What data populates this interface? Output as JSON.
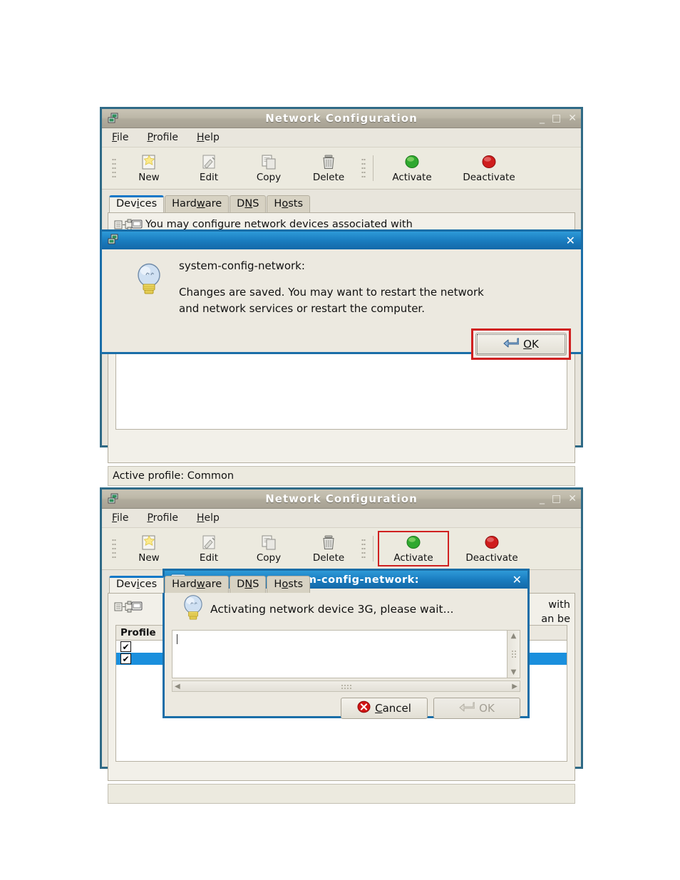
{
  "window1": {
    "title": "Network Configuration",
    "app_icon": "network-devices-icon",
    "controls": {
      "minimize": "_",
      "maximize": "□",
      "close": "✕"
    },
    "menubar": [
      {
        "label": "File",
        "mnemonic": "F"
      },
      {
        "label": "Profile",
        "mnemonic": "P"
      },
      {
        "label": "Help",
        "mnemonic": "H"
      }
    ],
    "toolbar": [
      {
        "label": "New",
        "icon": "new-document-icon",
        "highlighted": false
      },
      {
        "label": "Edit",
        "icon": "edit-pencil-icon",
        "highlighted": false
      },
      {
        "label": "Copy",
        "icon": "copy-pages-icon",
        "highlighted": false
      },
      {
        "label": "Delete",
        "icon": "trash-can-icon",
        "highlighted": false
      },
      {
        "label": "Activate",
        "icon": "green-light-icon",
        "highlighted": false
      },
      {
        "label": "Deactivate",
        "icon": "red-light-icon",
        "highlighted": false
      }
    ],
    "tabs": [
      {
        "label": "Devices",
        "mnemonic": "i",
        "active": true
      },
      {
        "label": "Hardware",
        "mnemonic": "w",
        "active": false
      },
      {
        "label": "DNS",
        "mnemonic": "N",
        "active": false
      },
      {
        "label": "Hosts",
        "mnemonic": "o",
        "active": false
      }
    ],
    "description_line1": "You may configure network devices associated with",
    "statusbar": "Active profile: Common"
  },
  "dialog1": {
    "title": "",
    "app_icon": "network-devices-icon",
    "close": "✕",
    "bulb_icon": "light-bulb-icon",
    "heading": "system-config-network:",
    "message_line1": "Changes are saved. You may want to restart the network",
    "message_line2": "and network services or restart the computer.",
    "ok_button": {
      "label": "OK",
      "mnemonic": "O",
      "icon": "enter-arrow-icon",
      "highlighted": true
    }
  },
  "window2": {
    "title": "Network Configuration",
    "app_icon": "network-devices-icon",
    "controls": {
      "minimize": "_",
      "maximize": "□",
      "close": "✕"
    },
    "menubar": [
      {
        "label": "File",
        "mnemonic": "F"
      },
      {
        "label": "Profile",
        "mnemonic": "P"
      },
      {
        "label": "Help",
        "mnemonic": "H"
      }
    ],
    "toolbar": [
      {
        "label": "New",
        "icon": "new-document-icon",
        "highlighted": false
      },
      {
        "label": "Edit",
        "icon": "edit-pencil-icon",
        "highlighted": false
      },
      {
        "label": "Copy",
        "icon": "copy-pages-icon",
        "highlighted": false
      },
      {
        "label": "Delete",
        "icon": "trash-can-icon",
        "highlighted": false
      },
      {
        "label": "Activate",
        "icon": "green-light-icon",
        "highlighted": true
      },
      {
        "label": "Deactivate",
        "icon": "red-light-icon",
        "highlighted": false
      }
    ],
    "tabs": [
      {
        "label": "Devices",
        "mnemonic": "i",
        "active": true
      },
      {
        "label": "Hardware",
        "mnemonic": "w",
        "active": false
      },
      {
        "label": "DNS",
        "mnemonic": "N",
        "active": false
      },
      {
        "label": "Hosts",
        "mnemonic": "o",
        "active": false
      }
    ],
    "description_tail_line1": "with",
    "description_tail_line2": "an be",
    "list": {
      "column_header": "Profile",
      "rows": [
        {
          "checked": true,
          "selected": false,
          "check_glyph": "✔"
        },
        {
          "checked": true,
          "selected": true,
          "check_glyph": "✔"
        }
      ]
    }
  },
  "dialog2": {
    "title": "system-config-network:",
    "window_icon": "window-icon",
    "close": "✕",
    "bulb_icon": "light-bulb-icon",
    "message": "Activating network device 3G, please wait...",
    "log_text": "",
    "scrollbar_v": {
      "up": "▲",
      "down": "▼"
    },
    "scrollbar_h": {
      "left": "◀",
      "right": "▶"
    },
    "cancel_button": {
      "label": "Cancel",
      "mnemonic": "C",
      "icon": "red-x-circle-icon"
    },
    "ok_button": {
      "label": "OK",
      "mnemonic": "O",
      "icon": "enter-arrow-icon",
      "disabled": true
    }
  },
  "colors": {
    "window_frame": "#2f6a86",
    "dialog_frame": "#1a6ea8",
    "dialog_title_blue": "#1a7dc0",
    "highlight_red": "#d02020",
    "selection_blue": "#1a8fdd",
    "active_tab_blue": "#1278c8"
  }
}
